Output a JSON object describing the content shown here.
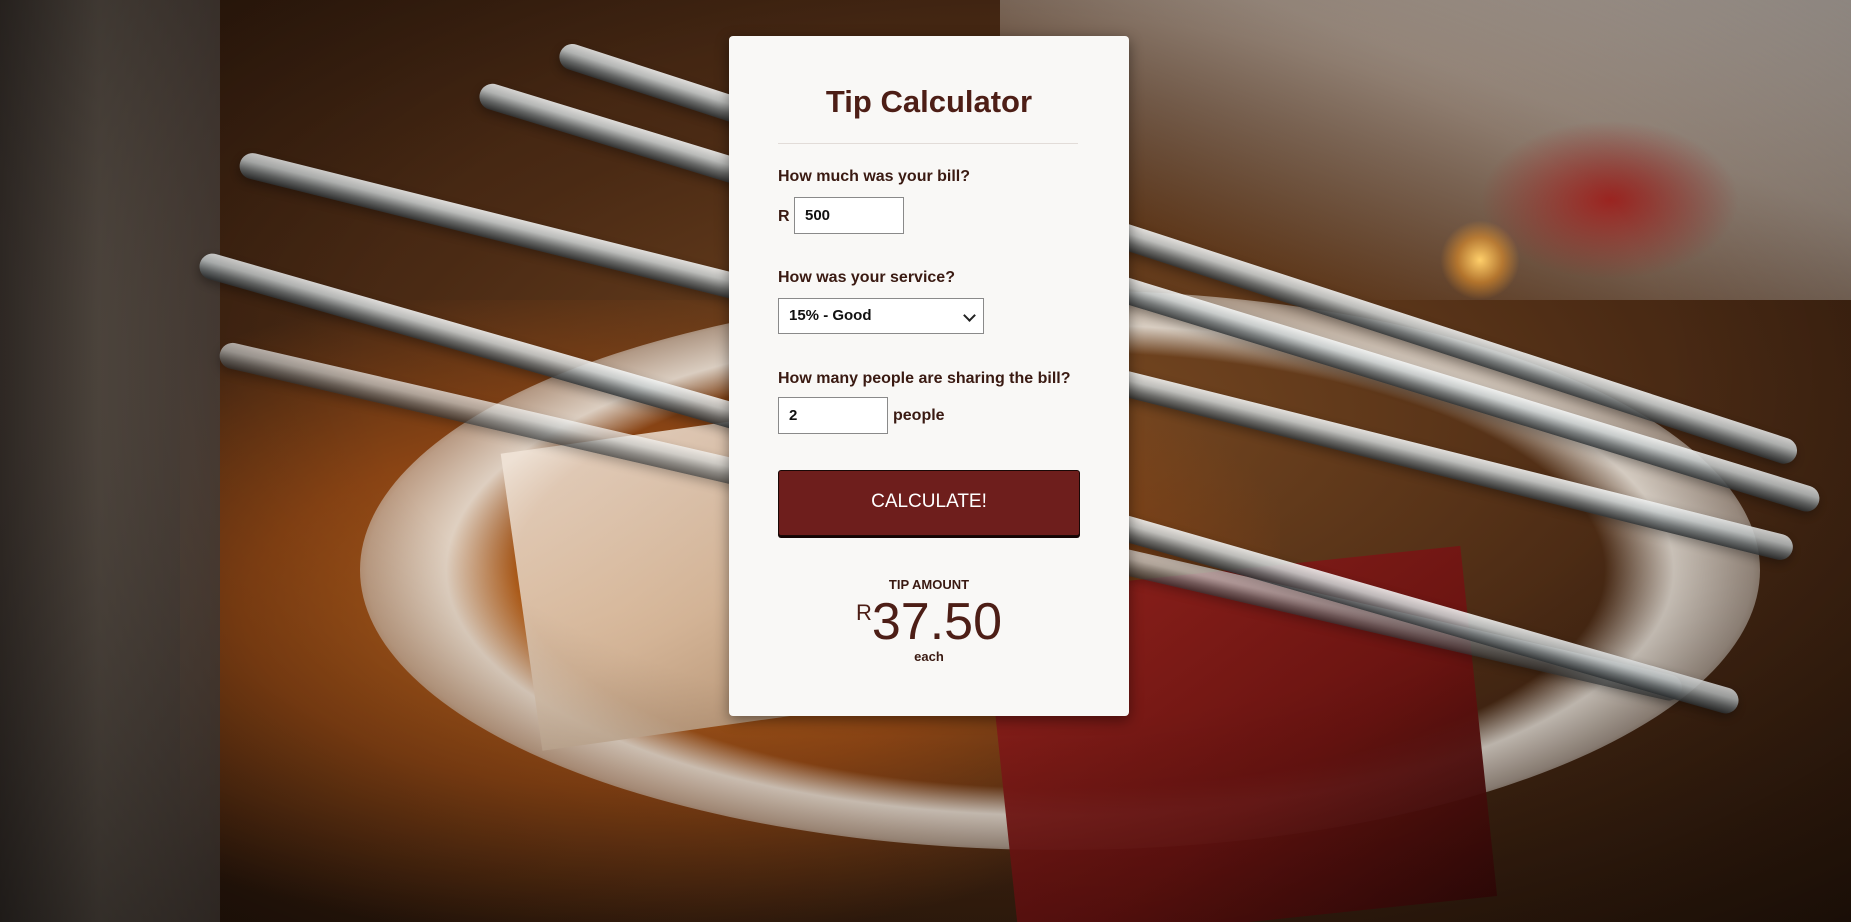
{
  "calculator": {
    "title": "Tip Calculator",
    "bill_label": "How much was your bill?",
    "currency_symbol": "R",
    "bill_value": "500",
    "service_label": "How was your service?",
    "service_selected": "15% - Good",
    "people_label": "How many people are sharing the bill?",
    "people_value": "2",
    "people_suffix": "people",
    "calculate_label": "CALCULATE!",
    "result": {
      "label": "TIP AMOUNT",
      "currency_symbol": "R",
      "amount": "37.50",
      "suffix": "each"
    }
  },
  "colors": {
    "accent": "#6e1e1c",
    "title_text": "#4d1e16",
    "card_background": "#f9f8f6"
  }
}
